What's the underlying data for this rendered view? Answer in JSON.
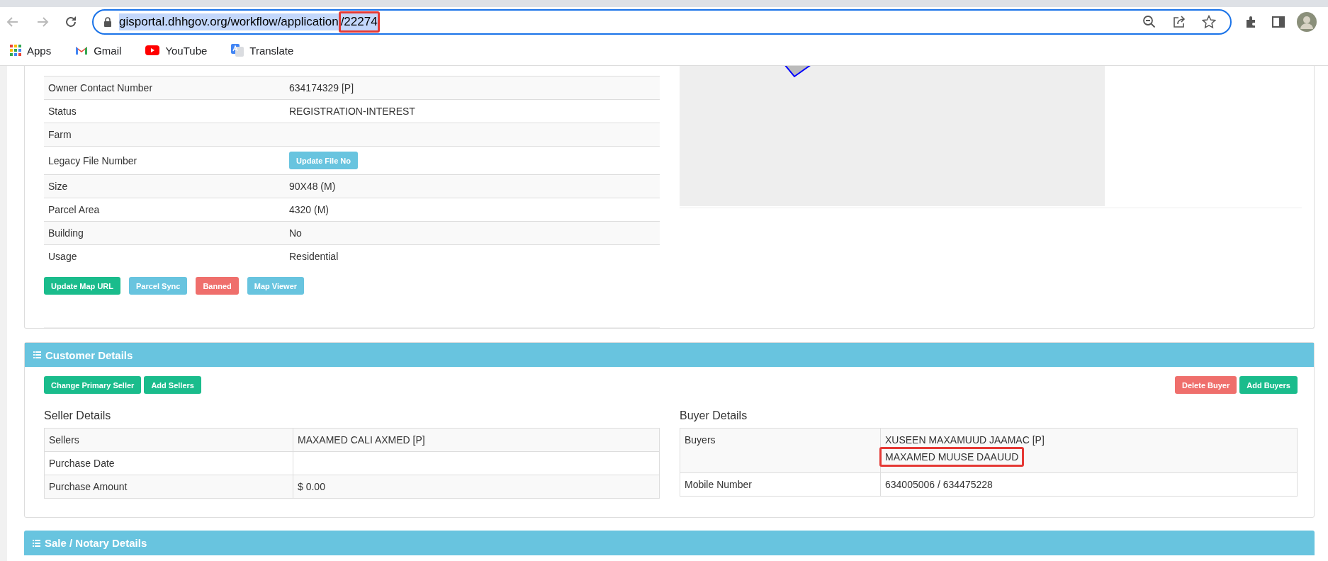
{
  "browser": {
    "url_parts": [
      {
        "text": "gisportal.dhhgov.org/workflow/application",
        "annotated": false
      },
      {
        "text": "/22274",
        "annotated": true
      }
    ],
    "url_selected": true,
    "bookmarks": [
      {
        "label": "Apps",
        "kind": "apps"
      },
      {
        "label": "Gmail",
        "kind": "gmail"
      },
      {
        "label": "YouTube",
        "kind": "youtube"
      },
      {
        "label": "Translate",
        "kind": "translate"
      }
    ]
  },
  "property_table": {
    "rows": [
      {
        "label": "Owner Contact Number",
        "kind": "text",
        "value": "634174329 [P]"
      },
      {
        "label": "Status",
        "kind": "text",
        "value": "REGISTRATION-INTEREST"
      },
      {
        "label": "Farm",
        "kind": "text",
        "value": ""
      },
      {
        "label": "Legacy File Number",
        "kind": "button",
        "value": "Update File No"
      },
      {
        "label": "Size",
        "kind": "text",
        "value": "90X48 (M)"
      },
      {
        "label": "Parcel Area",
        "kind": "text",
        "value": "4320 (M)"
      },
      {
        "label": "Building",
        "kind": "text",
        "value": "No"
      },
      {
        "label": "Usage",
        "kind": "text",
        "value": "Residential"
      }
    ]
  },
  "parcel_actions": [
    {
      "label": "Update Map URL",
      "kind": "success"
    },
    {
      "label": "Parcel Sync",
      "kind": "info"
    },
    {
      "label": "Banned",
      "kind": "danger"
    },
    {
      "label": "Map Viewer",
      "kind": "info"
    }
  ],
  "customer_details": {
    "title": "Customer Details",
    "seller_actions": [
      {
        "label": "Change Primary Seller",
        "kind": "success"
      },
      {
        "label": "Add Sellers",
        "kind": "success"
      }
    ],
    "buyer_actions": [
      {
        "label": "Delete Buyer",
        "kind": "danger"
      },
      {
        "label": "Add Buyers",
        "kind": "success"
      }
    ],
    "seller_details": {
      "title": "Seller Details",
      "rows": [
        {
          "label": "Sellers",
          "values": [
            {
              "text": "MAXAMED CALI AXMED [P]",
              "annotated": false
            }
          ]
        },
        {
          "label": "Purchase Date",
          "values": []
        },
        {
          "label": "Purchase Amount",
          "values": [
            {
              "text": "$ 0.00",
              "annotated": false
            }
          ]
        }
      ]
    },
    "buyer_details": {
      "title": "Buyer Details",
      "rows": [
        {
          "label": "Buyers",
          "values": [
            {
              "text": "XUSEEN MAXAMUUD JAAMAC [P]",
              "annotated": false
            },
            {
              "text": "MAXAMED MUUSE DAAUUD",
              "annotated": true
            }
          ]
        },
        {
          "label": "Mobile Number",
          "values": [
            {
              "text": "634005006 / 634475228",
              "annotated": false
            }
          ]
        }
      ]
    }
  },
  "sale_notary": {
    "title": "Sale / Notary Details"
  }
}
